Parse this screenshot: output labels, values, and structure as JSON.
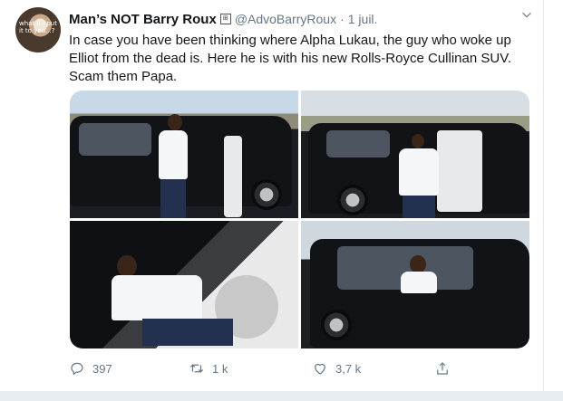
{
  "tweet": {
    "author_name": "Man’s NOT Barry Roux",
    "author_handle": "@AdvoBarryRoux",
    "separator": "·",
    "date": "1 juil.",
    "avatar_text": "what if I put it to you...?",
    "text": "In case you have been thinking where Alpha Lukau, the guy who woke up Elliot from the dead is. Here he is with his new Rolls-Royce Cullinan SUV. Scam them Papa.",
    "media_count": 4
  },
  "actions": {
    "reply_count": "397",
    "retweet_count": "1 k",
    "like_count": "3,7 k"
  },
  "icons": [
    "chevron-down-icon",
    "reply-icon",
    "retweet-icon",
    "heart-icon",
    "share-icon"
  ],
  "colors": {
    "text_primary": "#14171a",
    "text_secondary": "#657786",
    "divider": "#e6ecf0"
  }
}
